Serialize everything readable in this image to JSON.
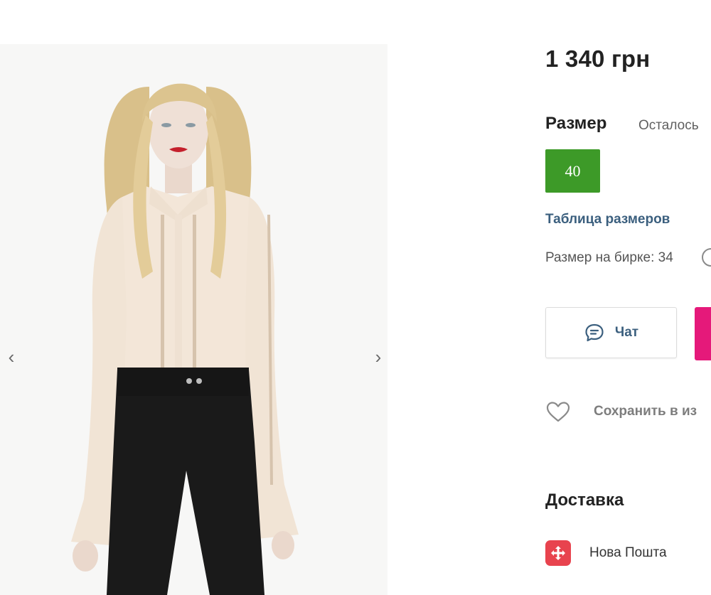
{
  "gallery": {
    "prev_arrow": "‹",
    "next_arrow": "›",
    "image_count": 2,
    "active_index": 0
  },
  "product": {
    "price": "1 340 грн",
    "size_title": "Размер",
    "remaining": "Осталось",
    "selected_size": "40",
    "size_table_link": "Таблица размеров",
    "tag_size": "Размер на бирке: 34",
    "chat_label": "Чат",
    "save_label": "Сохранить в из",
    "delivery_title": "Доставка",
    "carrier": "Нова Пошта"
  },
  "colors": {
    "size_chip": "#3d9a28",
    "buy_button": "#e5197a",
    "link": "#3b5f7e",
    "nova_poshta": "#e8434e"
  },
  "icons": {
    "chat": "chat-bubble-icon",
    "favorite": "heart-icon",
    "carrier": "nova-poshta-logo-icon",
    "info": "info-circle-icon"
  }
}
